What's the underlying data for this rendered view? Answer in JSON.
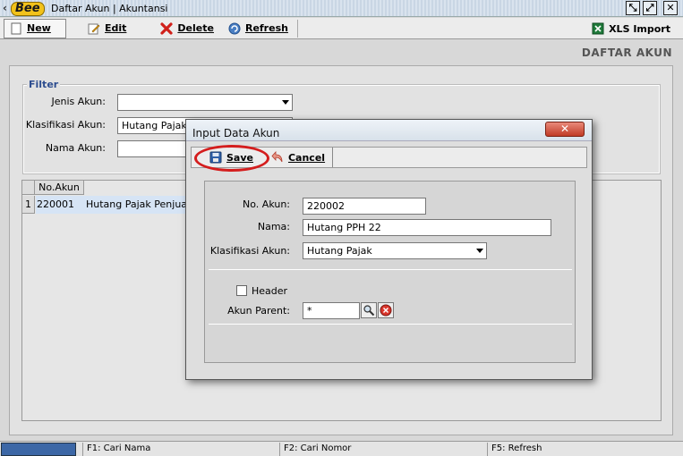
{
  "window": {
    "logo_text": "Bee",
    "title": "Daftar Akun | Akuntansi"
  },
  "toolbar": {
    "new_label": "New",
    "edit_label": "Edit",
    "delete_label": "Delete",
    "refresh_label": "Refresh",
    "xls_label": "XLS Import"
  },
  "page": {
    "title": "DAFTAR AKUN"
  },
  "filter": {
    "legend": "Filter",
    "jenis_label": "Jenis Akun:",
    "jenis_value": "",
    "klasifikasi_label": "Klasifikasi Akun:",
    "klasifikasi_value": "Hutang Pajak",
    "nama_label": "Nama Akun:",
    "nama_value": ""
  },
  "grid": {
    "columns": [
      "No.Akun"
    ],
    "rows": [
      {
        "row_no": "1",
        "no_akun": "220001",
        "nama": "Hutang Pajak Penjualan"
      }
    ]
  },
  "statusbar": {
    "f1": "F1: Cari Nama",
    "f2": "F2: Cari Nomor",
    "f5": "F5: Refresh"
  },
  "dialog": {
    "title": "Input Data Akun",
    "close_label": "✕",
    "save_label": "Save",
    "cancel_label": "Cancel",
    "no_akun_label": "No. Akun:",
    "no_akun_value": "220002",
    "nama_label": "Nama:",
    "nama_value": "Hutang PPH 22",
    "klasifikasi_label": "Klasifikasi Akun:",
    "klasifikasi_value": "Hutang Pajak",
    "header_label": "Header",
    "header_checked": false,
    "parent_label": "Akun Parent:",
    "parent_value": "*"
  },
  "colors": {
    "highlight": "#d41d1d",
    "accent": "#2d4d8f"
  }
}
